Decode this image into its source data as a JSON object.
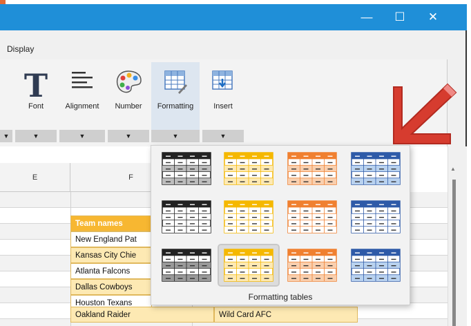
{
  "menu": {
    "display_label": "Display"
  },
  "window": {
    "minimize_glyph": "—",
    "maximize_glyph": "☐",
    "close_glyph": "✕",
    "accent_color": "#1f8fd8"
  },
  "ribbon": {
    "groups": [
      {
        "label": "Font",
        "icon": "font-icon"
      },
      {
        "label": "Alignment",
        "icon": "align-left-icon"
      },
      {
        "label": "Number",
        "icon": "palette-icon"
      },
      {
        "label": "Formatting",
        "icon": "table-format-icon"
      },
      {
        "label": "Insert",
        "icon": "insert-table-icon"
      }
    ],
    "dropdown_glyph": "▼"
  },
  "sheet": {
    "columns": [
      "E",
      "F"
    ],
    "rows": [
      {
        "f": "Team names",
        "g": ""
      },
      {
        "f": "New England Pat",
        "g": ""
      },
      {
        "f": "Kansas City Chie",
        "g": ""
      },
      {
        "f": "Atlanta Falcons",
        "g": ""
      },
      {
        "f": "Dallas Cowboys",
        "g": ""
      },
      {
        "f": "Houston Texans",
        "g": ""
      },
      {
        "f": "Oakland Raider",
        "g": "Wild Card AFC"
      }
    ]
  },
  "popup": {
    "label": "Formatting tables",
    "styles": [
      {
        "color": "#222222",
        "band": "#bdbdbd"
      },
      {
        "color": "#f5b800",
        "band": "#fde9b3"
      },
      {
        "color": "#f08030",
        "band": "#f9cfae"
      },
      {
        "color": "#2e5aa8",
        "band": "#b9d2ef"
      },
      {
        "color": "#222222",
        "band": "#ffffff"
      },
      {
        "color": "#f5b800",
        "band": "#ffffff"
      },
      {
        "color": "#f08030",
        "band": "#ffffff"
      },
      {
        "color": "#2e5aa8",
        "band": "#ffffff"
      },
      {
        "color": "#222222",
        "band": "#9a9a9a"
      },
      {
        "color": "#f5b800",
        "band": "#fde9b3"
      },
      {
        "color": "#f08030",
        "band": "#f9cfae"
      },
      {
        "color": "#2e5aa8",
        "band": "#b9d2ef"
      }
    ]
  },
  "annotation": {
    "arrow_color": "#d63c2f"
  }
}
